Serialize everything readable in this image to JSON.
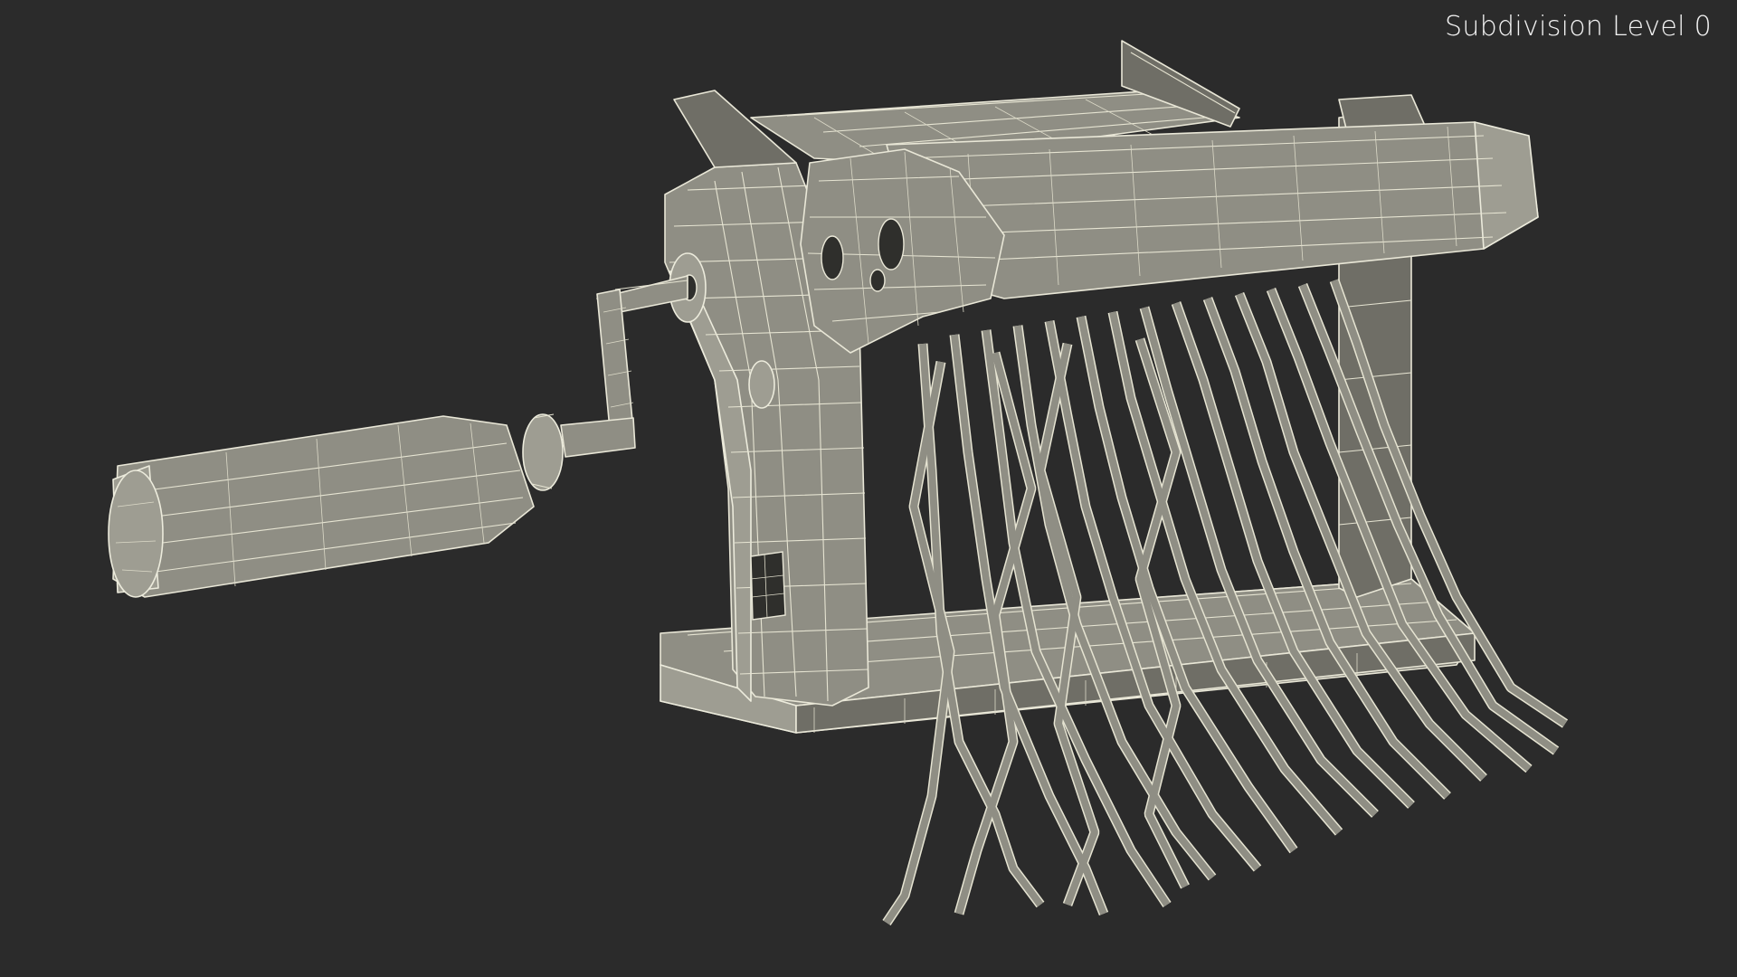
{
  "viewport": {
    "label": "Subdivision Level 0",
    "background": "#2b2b2b",
    "model_color": "#8f8e84",
    "wire_color": "#e9e7d7"
  }
}
